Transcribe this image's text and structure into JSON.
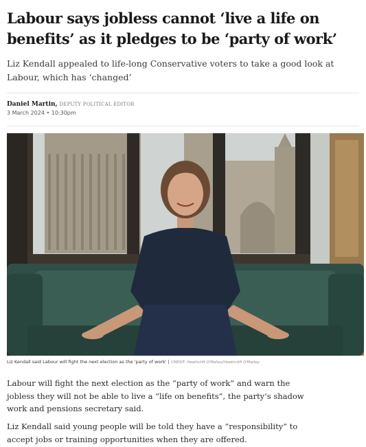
{
  "article": {
    "headline": "Labour says jobless cannot ‘live a life on benefits’ as it pledges to be ‘party of work’",
    "standfirst": "Liz Kendall appealed to life-long Conservative voters to take a good look at Labour, which has ‘changed’",
    "author": "Daniel Martin,",
    "author_role": "Deputy Political Editor",
    "date": "3 March 2024 • 10:30pm",
    "caption": "Liz Kendall said Labour will fight the next election as the 'party of work'",
    "caption_separator": "|",
    "credit": "CREDIT: Heathcliff O'Malley/Heathcliff O'Malley",
    "paragraphs": [
      "Labour will fight the next election as the “party of work” and warn the jobless they will not be able to live a “life on benefits”, the party’s shadow work and pensions secretary said.",
      "Liz Kendall said young people will be told they have a “responsibility” to accept jobs or training opportunities when they are offered."
    ]
  },
  "colors": {
    "text": "#1a1a1a",
    "muted": "#7a7a7a",
    "sofa": "#2f4f46",
    "dress": "#1f2a3d"
  }
}
